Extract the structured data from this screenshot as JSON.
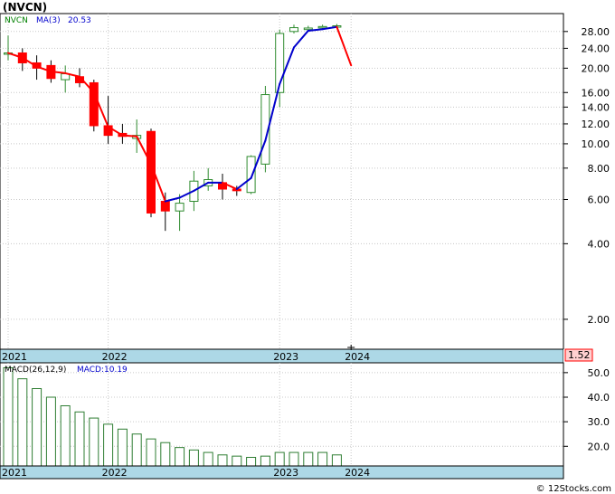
{
  "title": "(NVCN)",
  "watermark": "© 12Stocks.com",
  "price_panel": {
    "ticker": "NVCN",
    "ma_label": "MA(3)",
    "ma_value": "20.53",
    "last_price": "1.52"
  },
  "macd_panel": {
    "label": "MACD(26,12,9)",
    "value_label": "MACD:10.19"
  },
  "colors": {
    "up": "#2e8b2e",
    "down": "#ff0000",
    "ma_up": "#0000cc",
    "ma_down": "#ff0000",
    "macd_bar": "#2e7d32",
    "axis_band": "#add8e6",
    "ticker_text": "#008000",
    "ma_text": "#0000cc"
  },
  "chart_data": [
    {
      "type": "candlestick",
      "scale": "log",
      "ylim": [
        1.52,
        33
      ],
      "y_ticks": [
        "2.00",
        "4.00",
        "6.00",
        "8.00",
        "10.00",
        "12.00",
        "14.00",
        "16.00",
        "20.00",
        "24.00",
        "28.00"
      ],
      "x_labels": [
        {
          "label": "2021",
          "month": 0
        },
        {
          "label": "2022",
          "month": 7
        },
        {
          "label": "2023",
          "month": 19
        },
        {
          "label": "2024",
          "month": 24
        }
      ],
      "candles": [
        {
          "m": 0,
          "o": 23.0,
          "h": 27.0,
          "l": 21.5,
          "c": 23.0
        },
        {
          "m": 1,
          "o": 23.0,
          "h": 24.0,
          "l": 19.5,
          "c": 21.0
        },
        {
          "m": 2,
          "o": 21.0,
          "h": 22.5,
          "l": 18.0,
          "c": 20.0
        },
        {
          "m": 3,
          "o": 20.5,
          "h": 21.5,
          "l": 17.5,
          "c": 18.2
        },
        {
          "m": 4,
          "o": 18.0,
          "h": 20.5,
          "l": 16.0,
          "c": 19.0
        },
        {
          "m": 5,
          "o": 18.5,
          "h": 20.0,
          "l": 16.8,
          "c": 17.5
        },
        {
          "m": 6,
          "o": 17.5,
          "h": 18.0,
          "l": 11.2,
          "c": 11.8
        },
        {
          "m": 7,
          "o": 11.8,
          "h": 15.5,
          "l": 10.0,
          "c": 10.8
        },
        {
          "m": 8,
          "o": 11.0,
          "h": 12.0,
          "l": 10.0,
          "c": 10.7
        },
        {
          "m": 9,
          "o": 10.5,
          "h": 12.5,
          "l": 9.2,
          "c": 10.8
        },
        {
          "m": 10,
          "o": 11.2,
          "h": 11.5,
          "l": 5.1,
          "c": 5.3
        },
        {
          "m": 11,
          "o": 5.9,
          "h": 6.4,
          "l": 4.5,
          "c": 5.4
        },
        {
          "m": 12,
          "o": 5.4,
          "h": 6.3,
          "l": 4.5,
          "c": 5.8
        },
        {
          "m": 13,
          "o": 5.9,
          "h": 7.8,
          "l": 5.4,
          "c": 7.1
        },
        {
          "m": 14,
          "o": 6.8,
          "h": 8.0,
          "l": 6.5,
          "c": 7.2
        },
        {
          "m": 15,
          "o": 7.0,
          "h": 7.6,
          "l": 6.0,
          "c": 6.6
        },
        {
          "m": 16,
          "o": 6.6,
          "h": 6.8,
          "l": 6.2,
          "c": 6.5
        },
        {
          "m": 17,
          "o": 6.4,
          "h": 9.0,
          "l": 6.3,
          "c": 8.9
        },
        {
          "m": 18,
          "o": 8.3,
          "h": 17.0,
          "l": 7.7,
          "c": 15.7
        },
        {
          "m": 19,
          "o": 16.0,
          "h": 28.5,
          "l": 14.0,
          "c": 27.5
        },
        {
          "m": 20,
          "o": 28.0,
          "h": 29.8,
          "l": 27.5,
          "c": 29.0
        },
        {
          "m": 21,
          "o": 28.5,
          "h": 29.5,
          "l": 28.0,
          "c": 28.9
        },
        {
          "m": 22,
          "o": 29.0,
          "h": 29.8,
          "l": 28.5,
          "c": 29.3
        },
        {
          "m": 23,
          "o": 29.3,
          "h": 30.0,
          "l": 29.0,
          "c": 29.5
        }
      ],
      "ma": {
        "name": "MA(3)",
        "points": [
          {
            "m": 0,
            "v": 23.0
          },
          {
            "m": 1,
            "v": 22.0
          },
          {
            "m": 2,
            "v": 20.3
          },
          {
            "m": 3,
            "v": 19.4
          },
          {
            "m": 4,
            "v": 19.1
          },
          {
            "m": 5,
            "v": 18.5
          },
          {
            "m": 6,
            "v": 16.0
          },
          {
            "m": 7,
            "v": 11.7
          },
          {
            "m": 8,
            "v": 10.8
          },
          {
            "m": 9,
            "v": 10.7
          },
          {
            "m": 10,
            "v": 8.3
          },
          {
            "m": 11,
            "v": 5.9
          },
          {
            "m": 12,
            "v": 6.1
          },
          {
            "m": 13,
            "v": 6.5
          },
          {
            "m": 14,
            "v": 7.0
          },
          {
            "m": 15,
            "v": 7.0
          },
          {
            "m": 16,
            "v": 6.6
          },
          {
            "m": 17,
            "v": 7.3
          },
          {
            "m": 18,
            "v": 10.3
          },
          {
            "m": 19,
            "v": 17.3
          },
          {
            "m": 20,
            "v": 24.2
          },
          {
            "m": 21,
            "v": 28.2
          },
          {
            "m": 22,
            "v": 28.6
          },
          {
            "m": 23,
            "v": 29.2
          },
          {
            "m": 24,
            "v": 20.53
          }
        ]
      },
      "last_price": 1.52
    },
    {
      "type": "bar",
      "name": "MACD(26,12,9)",
      "ylim": [
        12,
        54
      ],
      "y_ticks": [
        "20.0",
        "30.0",
        "40.0",
        "50.0"
      ],
      "x_labels": [
        {
          "label": "2021",
          "month": 0
        },
        {
          "label": "2022",
          "month": 7
        },
        {
          "label": "2023",
          "month": 19
        },
        {
          "label": "2024",
          "month": 24
        }
      ],
      "months": [
        0,
        1,
        2,
        3,
        4,
        5,
        6,
        7,
        8,
        9,
        10,
        11,
        12,
        13,
        14,
        15,
        16,
        17,
        18,
        19,
        20,
        21,
        22,
        23
      ],
      "values": [
        52.0,
        47.5,
        43.5,
        40.0,
        36.5,
        34.0,
        31.5,
        29.0,
        27.0,
        25.0,
        23.0,
        21.5,
        19.5,
        18.5,
        17.5,
        16.5,
        16.0,
        15.5,
        16.0,
        17.5,
        17.5,
        17.5,
        17.5,
        16.5
      ]
    }
  ]
}
